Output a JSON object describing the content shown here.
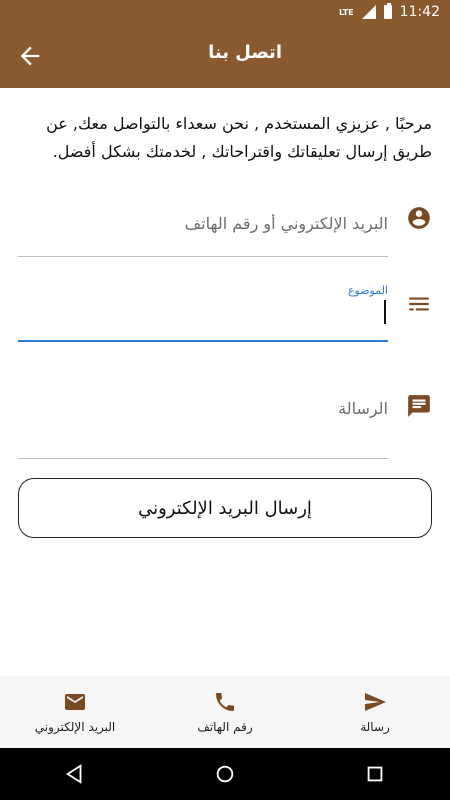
{
  "status_bar": {
    "network": "LTE",
    "time": "11:42"
  },
  "app_bar": {
    "title": "اتصل بنا"
  },
  "intro_text": "مرحبًا , عزيزي المستخدم , نحن سعداء بالتواصل معك, عن طريق إرسال تعليقاتك واقتراحاتك , لخدمتك بشكل أفضل.",
  "form": {
    "contact": {
      "placeholder": "البريد الإلكتروني أو رقم الهاتف",
      "value": "",
      "icon": "account-circle-icon"
    },
    "subject": {
      "label": "الموضوع",
      "value": "",
      "icon": "notes-icon"
    },
    "message": {
      "placeholder": "الرسالة",
      "value": "",
      "icon": "chat-icon"
    }
  },
  "send_button": {
    "label": "إرسال البريد الإلكتروني"
  },
  "bottom_nav": {
    "items": [
      {
        "label": "البريد الإلكتروني",
        "icon": "email-icon"
      },
      {
        "label": "رقم الهاتف",
        "icon": "phone-icon"
      },
      {
        "label": "رسالة",
        "icon": "send-icon"
      }
    ]
  },
  "colors": {
    "primary": "#8a5a2e",
    "accent": "#2a7fd4",
    "icon": "#7a4a22"
  }
}
